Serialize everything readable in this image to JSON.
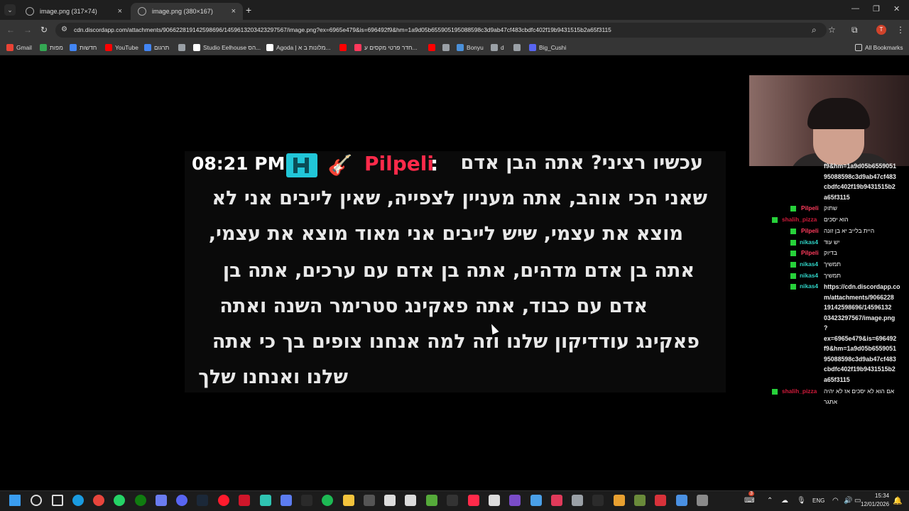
{
  "browser": {
    "tabs": [
      {
        "label": "image.png (317×74)",
        "close": "×"
      },
      {
        "label": "image.png (380×167)",
        "close": "×"
      }
    ],
    "new_tab": "+",
    "menu_arrow": "⌄",
    "window_controls": {
      "minimize": "—",
      "maximize": "❐",
      "close": "✕"
    },
    "url": "cdn.discordapp.com/attachments/906622819142598696/1459613203423297567/image.png?ex=6965e479&is=696492f9&hm=1a9d05b655905195088598c3d9ab47cf483cbdfc402f19b9431515b2a65f3115",
    "profile_initial": "T",
    "bookmarks": [
      {
        "label": "Gmail",
        "color": "#ea4335"
      },
      {
        "label": "מפות",
        "color": "#34a853"
      },
      {
        "label": "חדשות",
        "color": "#4285f4"
      },
      {
        "label": "YouTube",
        "color": "#ff0000"
      },
      {
        "label": "תרגום",
        "color": "#4285f4"
      },
      {
        "label": "",
        "color": "#9aa0a6"
      },
      {
        "label": "Studio Eelhouse הס...",
        "color": "#ffffff"
      },
      {
        "label": "Agoda | מלונות ב א...",
        "color": "#ffffff"
      },
      {
        "label": "",
        "color": "#ff0000"
      },
      {
        "label": "חדר פרטי מקסים ע...",
        "color": "#ff385c"
      },
      {
        "label": "",
        "color": "#ff0000"
      },
      {
        "label": "",
        "color": "#9aa0a6"
      },
      {
        "label": "Bonyu",
        "color": "#4a90d9"
      },
      {
        "label": "d",
        "color": "#9aa0a6"
      },
      {
        "label": "",
        "color": "#9aa0a6"
      },
      {
        "label": "Big_Cushi",
        "color": "#5865f2"
      }
    ],
    "all_bookmarks": "All Bookmarks"
  },
  "chat_message": {
    "time": "08:21 PM",
    "username": "Pilpeli",
    "colon": ":",
    "lines": [
      "עכשיו רציני? אתה הבן אדם",
      "שאני הכי אוהב, אתה מעניין לצפייה, שאין לייבים אני לא",
      "מוצא את עצמי, שיש לייבים אני מאוד מוצא את עצמי,",
      "אתה בן אדם מדהים, אתה בן אדם עם ערכים, אתה בן",
      "אדם עם כבוד, אתה פאקינג סטרימר השנה ואתה",
      "פאקינג עודדיקון שלנו וזה למה אנחנו צופים בך כי אתה",
      "שלנו ואנחנו שלך"
    ]
  },
  "side_chat": {
    "url_top": [
      "f9&hm=1a9d05b6559051",
      "95088598c3d9ab47cf483",
      "cbdfc402f19b9431515b2",
      "a65f3115"
    ],
    "messages": [
      {
        "name": "Pilpeli",
        "color": "#ff3b5c",
        "text": "שתוק"
      },
      {
        "name": "shalih_pizza",
        "color": "#d01a3a",
        "text": "הוא יסכים"
      },
      {
        "name": "Pilpeli",
        "color": "#ff3b5c",
        "text": "היית בלייב יא בן זונה"
      },
      {
        "name": "nikas4",
        "color": "#2fd1c4",
        "text": "יש עוד"
      },
      {
        "name": "Pilpeli",
        "color": "#ff3b5c",
        "text": "בדיוק"
      },
      {
        "name": "nikas4",
        "color": "#2fd1c4",
        "text": "תמשיך"
      },
      {
        "name": "nikas4",
        "color": "#2fd1c4",
        "text": "תמשיך"
      },
      {
        "name": "nikas4",
        "color": "#2fd1c4",
        "text": ""
      }
    ],
    "url_bottom": [
      "https://cdn.discordapp.co",
      "m/attachments/9066228",
      "19142598696/14596132",
      "03423297567/image.png",
      "?",
      "ex=6965e479&is=696492",
      "f9&hm=1a9d05b6559051",
      "95088598c3d9ab47cf483",
      "cbdfc402f19b9431515b2",
      "a65f3115"
    ],
    "last_message": {
      "name": "shalih_pizza",
      "color": "#d01a3a",
      "text": "אם הוא לא יסכים אז לא יהיה",
      "text2": "אתגר"
    }
  },
  "taskbar": {
    "icons": [
      {
        "name": "windows-start-icon",
        "color": "#3a9df0"
      },
      {
        "name": "search-icon",
        "color": "#dcdcdc"
      },
      {
        "name": "task-view-icon",
        "color": "#dcdcdc"
      },
      {
        "name": "edge-icon",
        "color": "#1a9be0"
      },
      {
        "name": "chrome-icon",
        "color": "#e8453c"
      },
      {
        "name": "whatsapp-icon",
        "color": "#25d366"
      },
      {
        "name": "xbox-icon",
        "color": "#107c10"
      },
      {
        "name": "copilot-icon",
        "color": "#6a7cf0"
      },
      {
        "name": "discord-icon",
        "color": "#5865f2"
      },
      {
        "name": "steam-icon",
        "color": "#1b2838"
      },
      {
        "name": "opera-icon",
        "color": "#ff1b2d"
      },
      {
        "name": "media-icon",
        "color": "#d0162a"
      },
      {
        "name": "app-icon-1",
        "color": "#2fc4b2"
      },
      {
        "name": "app-icon-2",
        "color": "#5c7cf0"
      },
      {
        "name": "app-icon-3",
        "color": "#2a2a2a"
      },
      {
        "name": "spotify-icon",
        "color": "#1db954"
      },
      {
        "name": "file-explorer-icon",
        "color": "#f3c33c"
      },
      {
        "name": "app-icon-4",
        "color": "#555555"
      },
      {
        "name": "epic-icon",
        "color": "#dcdcdc"
      },
      {
        "name": "capcut-icon",
        "color": "#dcdcdc"
      },
      {
        "name": "minecraft-icon",
        "color": "#55aa3a"
      },
      {
        "name": "app-icon-5",
        "color": "#333333"
      },
      {
        "name": "heart-icon",
        "color": "#ff2a4a"
      },
      {
        "name": "notepad-icon",
        "color": "#dcdcdc"
      },
      {
        "name": "clapper-icon",
        "color": "#7a4cc8"
      },
      {
        "name": "app-icon-6",
        "color": "#4aa0e8"
      },
      {
        "name": "app-icon-7",
        "color": "#e03a5a"
      },
      {
        "name": "app-icon-8",
        "color": "#9aa0a6"
      },
      {
        "name": "epic-games-icon",
        "color": "#2b2b2b"
      },
      {
        "name": "app-icon-9",
        "color": "#e8a030"
      },
      {
        "name": "app-icon-10",
        "color": "#6a8a3a"
      },
      {
        "name": "app-icon-11",
        "color": "#d8323a"
      },
      {
        "name": "app-icon-12",
        "color": "#4a90e2"
      },
      {
        "name": "app-icon-13",
        "color": "#8a8a8a"
      }
    ],
    "lang": "ENG",
    "time": "15:34",
    "date": "12/01/2026",
    "notification_count": "3"
  }
}
